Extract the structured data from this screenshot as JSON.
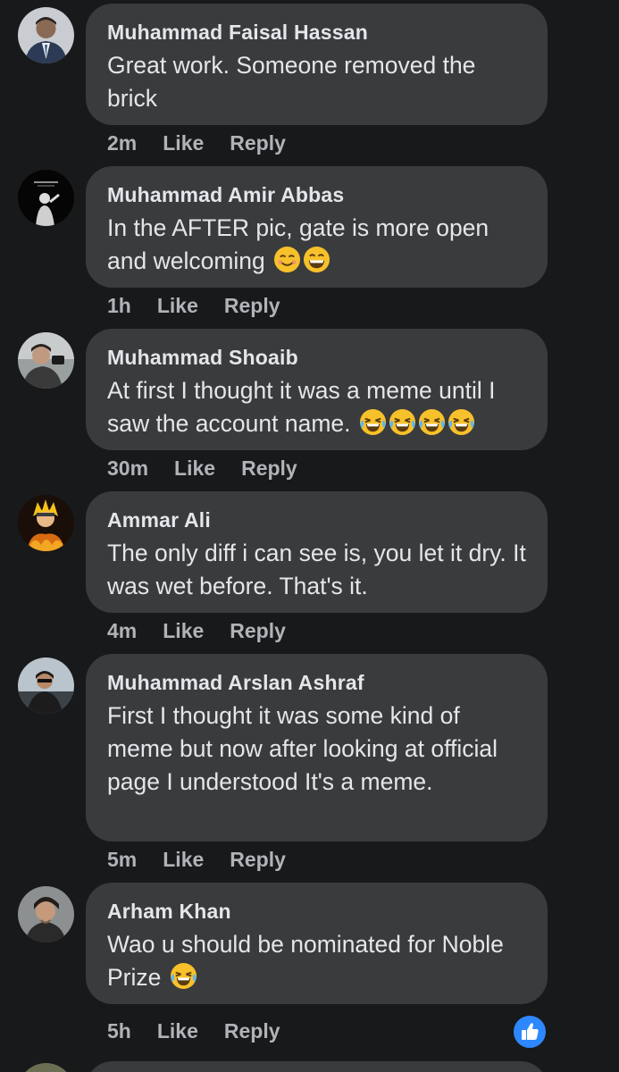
{
  "comments": [
    {
      "author": "Muhammad Faisal Hassan",
      "text": "Great work. Someone removed the brick",
      "time": "2m",
      "like_label": "Like",
      "reply_label": "Reply",
      "emojis": []
    },
    {
      "author": "Muhammad Amir Abbas",
      "text": "In the AFTER pic, gate is more open and welcoming",
      "time": "1h",
      "like_label": "Like",
      "reply_label": "Reply",
      "emojis": [
        "smiling-face-icon",
        "grinning-face-icon"
      ]
    },
    {
      "author": "Muhammad Shoaib",
      "text": "At first I thought it was a meme until I saw the account name.",
      "time": "30m",
      "like_label": "Like",
      "reply_label": "Reply",
      "emojis": [
        "tears-of-joy-icon",
        "tears-of-joy-icon",
        "tears-of-joy-icon",
        "tears-of-joy-icon"
      ]
    },
    {
      "author": "Ammar Ali",
      "text": "The only diff i can see is, you let it dry. It was wet before. That's it.",
      "time": "4m",
      "like_label": "Like",
      "reply_label": "Reply",
      "emojis": []
    },
    {
      "author": "Muhammad Arslan Ashraf",
      "text": "First I thought it was some kind of meme but now after looking at official page I understood It's a meme.",
      "time": "5m",
      "like_label": "Like",
      "reply_label": "Reply",
      "emojis": []
    },
    {
      "author": "Arham Khan",
      "text": "Wao u should be nominated for Noble Prize",
      "time": "5h",
      "like_label": "Like",
      "reply_label": "Reply",
      "emojis": [
        "tears-of-joy-icon"
      ]
    }
  ],
  "reaction_icon": "thumbs-up-icon",
  "colors": {
    "background": "#18191a",
    "bubble": "#3a3b3c",
    "primary_text": "#e4e6eb",
    "secondary_text": "#b0b3b8",
    "like_blue": "#2d88ff",
    "emoji_yellow": "#f7c12b"
  }
}
